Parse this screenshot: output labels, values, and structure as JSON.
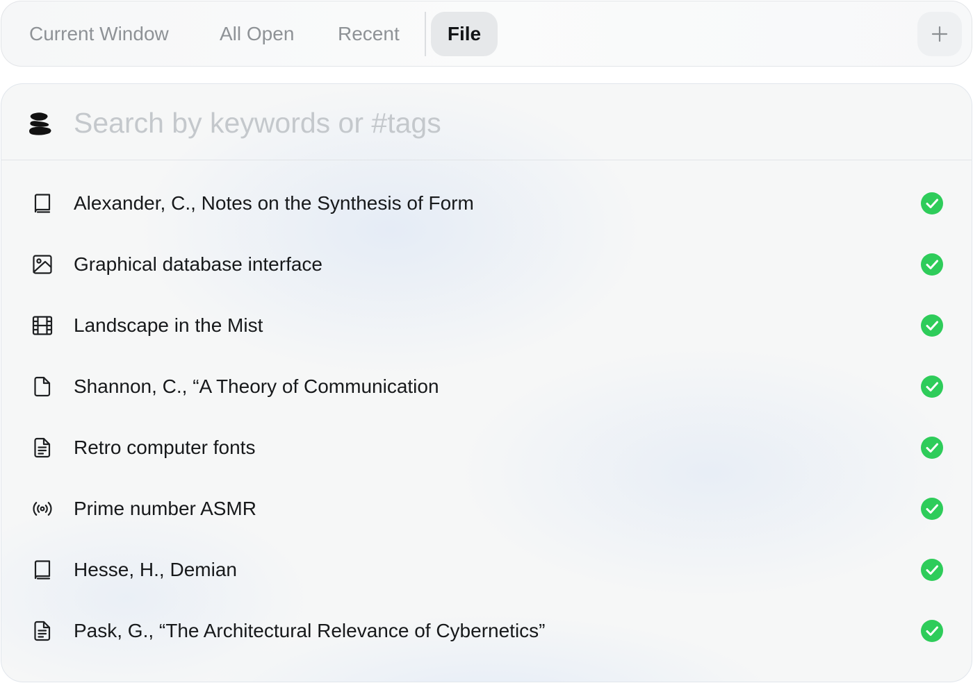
{
  "tabs": [
    {
      "label": "Current Window",
      "active": false
    },
    {
      "label": "All Open",
      "active": false
    },
    {
      "label": "Recent",
      "active": false
    },
    {
      "label": "File",
      "active": true
    }
  ],
  "add_button_icon": "plus-icon",
  "search": {
    "placeholder": "Search by keywords or #tags",
    "value": "",
    "icon": "stacked-stones-logo-icon"
  },
  "items": [
    {
      "icon": "book-icon",
      "title": "Alexander, C., Notes on the Synthesis of Form",
      "status": "check-circle-icon"
    },
    {
      "icon": "image-icon",
      "title": "Graphical database interface",
      "status": "check-circle-icon"
    },
    {
      "icon": "film-icon",
      "title": "Landscape in the Mist",
      "status": "check-circle-icon"
    },
    {
      "icon": "file-icon",
      "title": "Shannon, C., “A Theory of Communication",
      "status": "check-circle-icon"
    },
    {
      "icon": "document-text-icon",
      "title": "Retro computer fonts",
      "status": "check-circle-icon"
    },
    {
      "icon": "broadcast-icon",
      "title": "Prime number ASMR",
      "status": "check-circle-icon"
    },
    {
      "icon": "book-icon",
      "title": "Hesse, H., Demian",
      "status": "check-circle-icon"
    },
    {
      "icon": "document-text-icon",
      "title": "Pask, G., “The Architectural Relevance of Cybernetics”",
      "status": "check-circle-icon"
    }
  ],
  "colors": {
    "accent_green": "#2ecc5a",
    "active_tab_bg": "#e6e8ea",
    "text_primary": "#17191b",
    "text_muted": "#8e9296"
  }
}
